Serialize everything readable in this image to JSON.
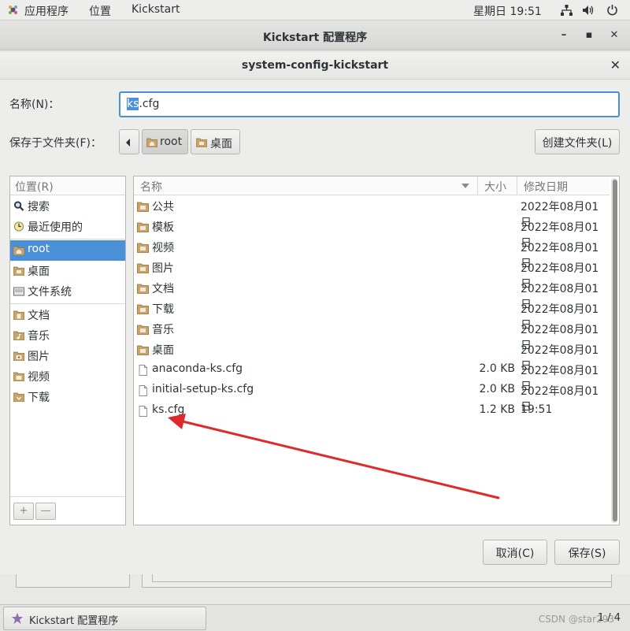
{
  "topbar": {
    "apps": "应用程序",
    "places": "位置",
    "app_name": "Kickstart",
    "clock": "星期日 19:51"
  },
  "main_window": {
    "title": "Kickstart 配置程序"
  },
  "dialog": {
    "title": "system-config-kickstart",
    "name_label": "名称(N)：",
    "filename_selected": "ks",
    "filename_rest": ".cfg",
    "folder_label": "保存于文件夹(F)：",
    "path": [
      {
        "label": "root",
        "icon": "home-folder-icon",
        "active": true
      },
      {
        "label": "桌面",
        "icon": "desktop-folder-icon",
        "active": false
      }
    ],
    "create_folder": "创建文件夹(L)",
    "cancel": "取消(C)",
    "save": "保存(S)"
  },
  "places": {
    "header": "位置(R)",
    "items": [
      {
        "label": "搜索",
        "icon": "search-icon"
      },
      {
        "label": "最近使用的",
        "icon": "recent-icon"
      },
      {
        "label": "root",
        "icon": "home-folder-icon",
        "selected": true
      },
      {
        "label": "桌面",
        "icon": "desktop-folder-icon"
      },
      {
        "label": "文件系统",
        "icon": "drive-icon"
      },
      {
        "label": "文档",
        "icon": "documents-folder-icon"
      },
      {
        "label": "音乐",
        "icon": "music-folder-icon"
      },
      {
        "label": "图片",
        "icon": "pictures-folder-icon"
      },
      {
        "label": "视频",
        "icon": "videos-folder-icon"
      },
      {
        "label": "下载",
        "icon": "downloads-folder-icon"
      }
    ],
    "add": "+",
    "remove": "—"
  },
  "files": {
    "columns": {
      "name": "名称",
      "size": "大小",
      "modified": "修改日期"
    },
    "rows": [
      {
        "name": "公共",
        "size": "",
        "date": "2022年08月01日",
        "type": "folder"
      },
      {
        "name": "模板",
        "size": "",
        "date": "2022年08月01日",
        "type": "folder"
      },
      {
        "name": "视频",
        "size": "",
        "date": "2022年08月01日",
        "type": "folder"
      },
      {
        "name": "图片",
        "size": "",
        "date": "2022年08月01日",
        "type": "folder"
      },
      {
        "name": "文档",
        "size": "",
        "date": "2022年08月01日",
        "type": "folder"
      },
      {
        "name": "下载",
        "size": "",
        "date": "2022年08月01日",
        "type": "folder"
      },
      {
        "name": "音乐",
        "size": "",
        "date": "2022年08月01日",
        "type": "folder"
      },
      {
        "name": "桌面",
        "size": "",
        "date": "2022年08月01日",
        "type": "folder"
      },
      {
        "name": "anaconda-ks.cfg",
        "size": "2.0 KB",
        "date": "2022年08月01日",
        "type": "file"
      },
      {
        "name": "initial-setup-ks.cfg",
        "size": "2.0 KB",
        "date": "2022年08月01日",
        "type": "file"
      },
      {
        "name": "ks.cfg",
        "size": "1.2 KB",
        "date": "19:51",
        "type": "file"
      }
    ]
  },
  "taskbar": {
    "item": "Kickstart 配置程序",
    "pager": "1 / 4",
    "watermark": "CSDN @star293"
  },
  "colors": {
    "accent": "#4a90d9",
    "annotation_arrow": "#e0292b",
    "folder": "#c8a468"
  }
}
